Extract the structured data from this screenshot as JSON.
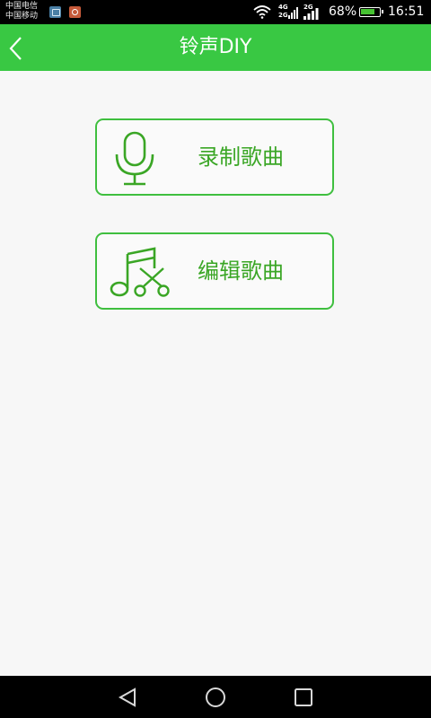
{
  "status_bar": {
    "carrier_1": "中国电信",
    "carrier_2": "中国移动",
    "network_1": "4G",
    "network_2": "2G",
    "network_3": "2G",
    "battery": "68%",
    "time": "16:51"
  },
  "header": {
    "title": "铃声DIY",
    "background_color": "#39c843",
    "back_icon": "chevron-left-icon"
  },
  "actions": [
    {
      "label": "录制歌曲",
      "icon": "microphone-icon"
    },
    {
      "label": "编辑歌曲",
      "icon": "music-scissors-icon"
    }
  ],
  "nav_bar": {
    "back_icon": "triangle-back-icon",
    "home_icon": "circle-home-icon",
    "recent_icon": "square-recent-icon"
  },
  "colors": {
    "accent": "#39c843",
    "card_text": "#3aa625",
    "card_border": "#3fbf3f"
  }
}
